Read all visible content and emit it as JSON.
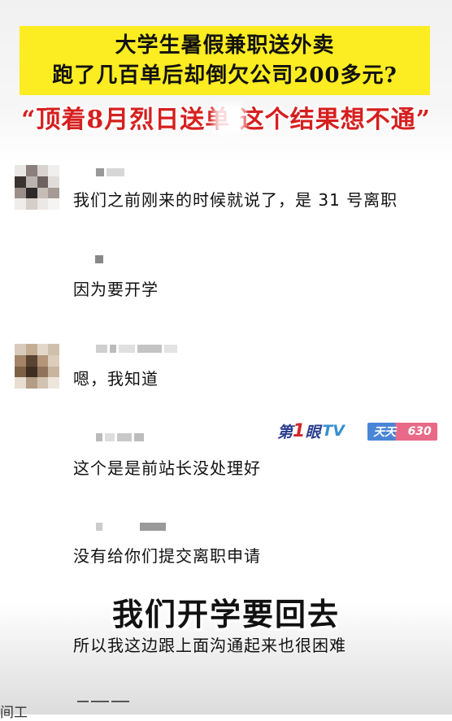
{
  "banner": {
    "line1": "大学生暑假兼职送外卖",
    "line2": "跑了几百单后却倒欠公司200多元?",
    "quote": "“顶着8月烈日送单 这个结果想不通”",
    "bg_color": "#fcec22",
    "quote_color": "#d61f1f"
  },
  "chat": {
    "messages": [
      {
        "text": "我们之前刚来的时候就说了，是 31 号离职"
      },
      {
        "text": "因为要开学"
      },
      {
        "text": "嗯，我知道"
      },
      {
        "text": "这个是是前站长没处理好"
      },
      {
        "text": "没有给你们提交离职申请"
      },
      {
        "text": "所以我这边跟上面沟通起来也很困难"
      }
    ],
    "partial_bottom": "间工"
  },
  "watermark": {
    "channel_prefix": "第",
    "channel_one": "1",
    "channel_mid": "眼",
    "channel_suffix": "TV",
    "badge_left": "天天",
    "badge_right": "630"
  },
  "caption": {
    "text": "我们开学要回去"
  }
}
